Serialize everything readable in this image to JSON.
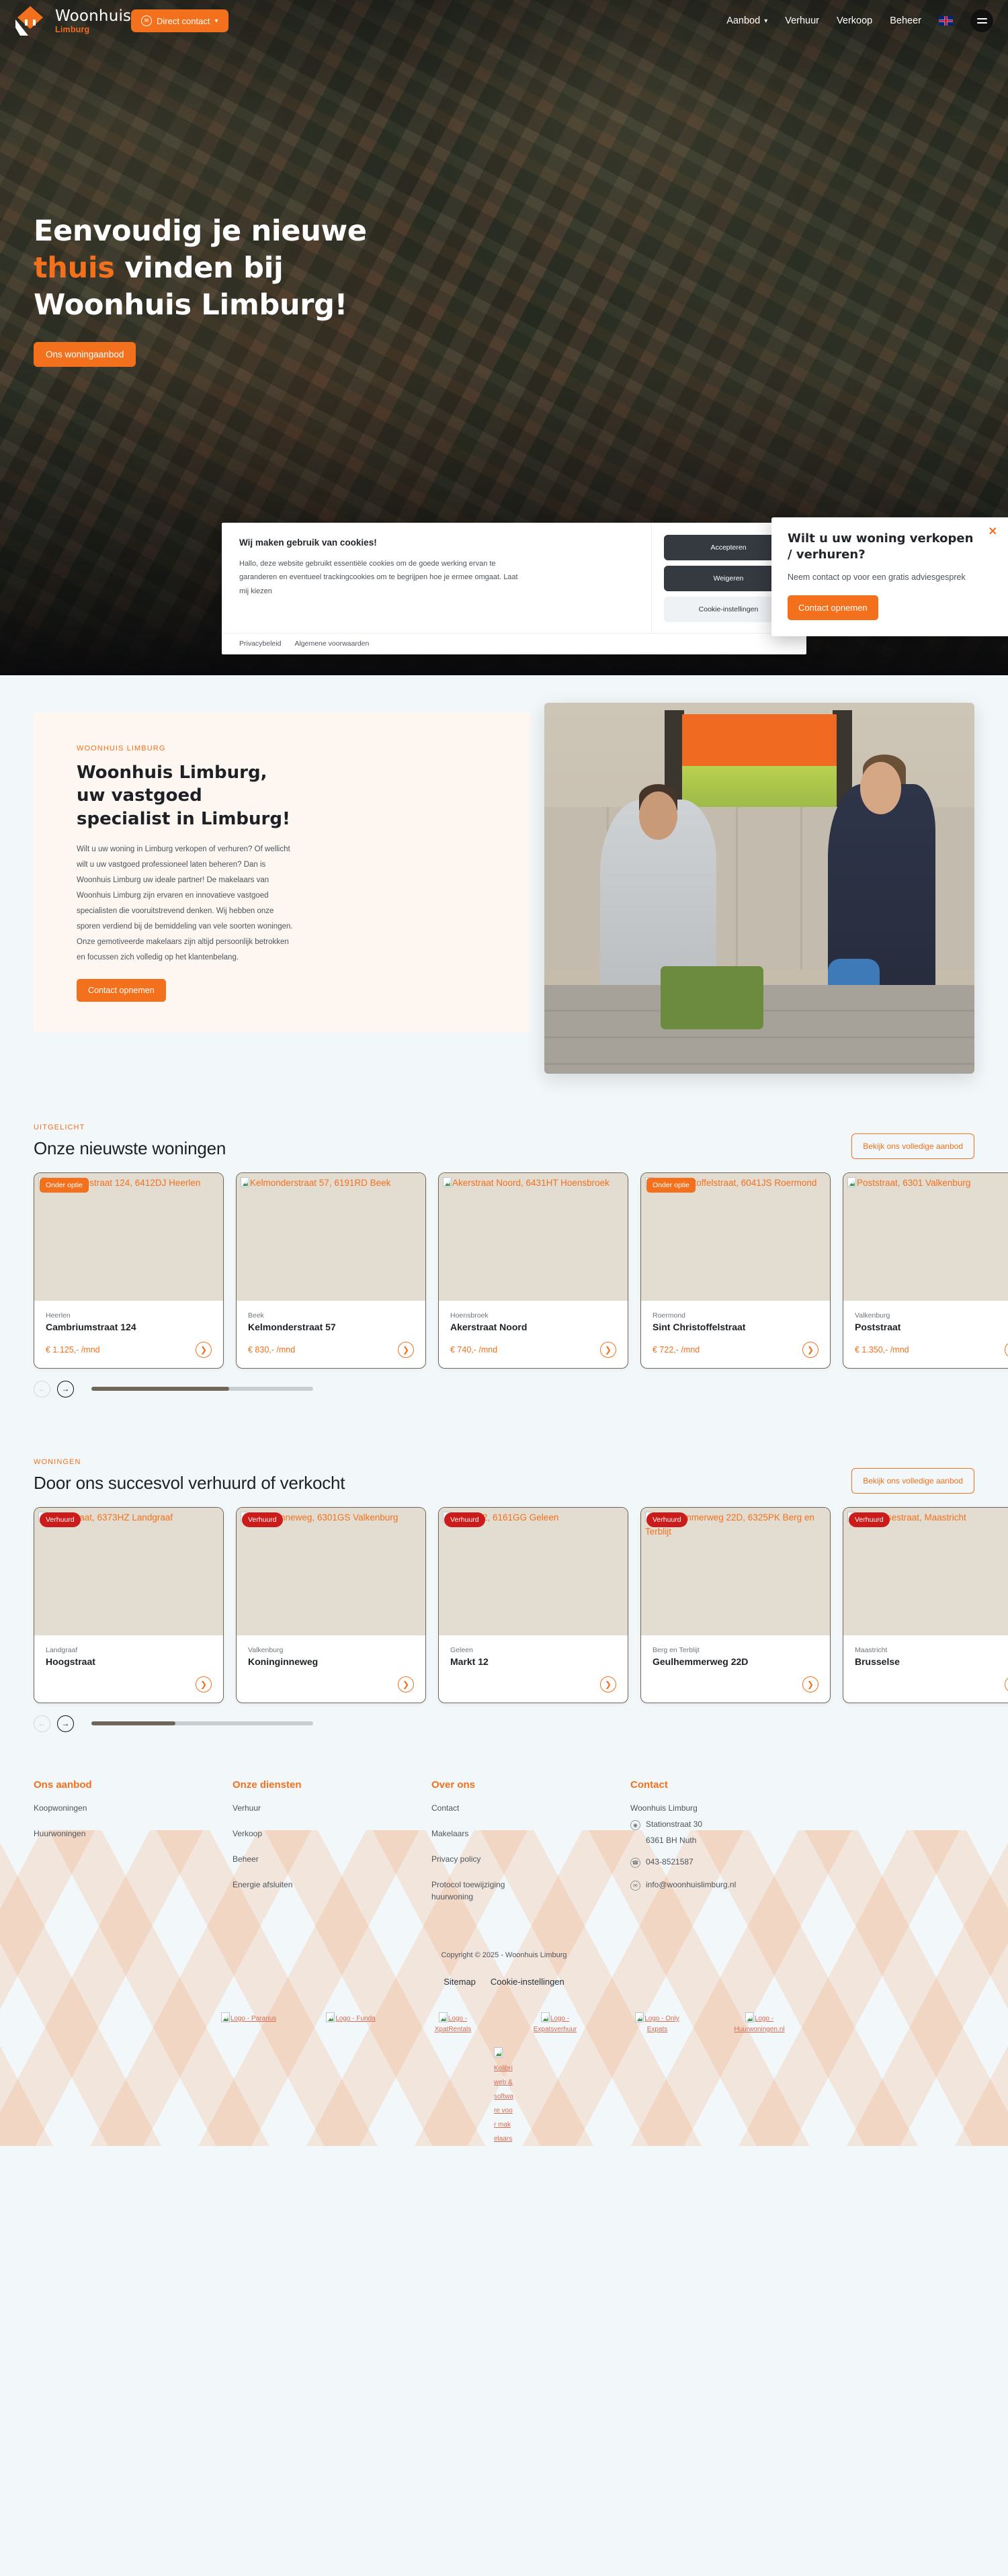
{
  "header": {
    "logo_main": "Woonhuis",
    "logo_sub": "Limburg",
    "direct_contact": "Direct contact",
    "nav": [
      {
        "label": "Aanbod",
        "has_chevron": true
      },
      {
        "label": "Verhuur",
        "has_chevron": false
      },
      {
        "label": "Verkoop",
        "has_chevron": false
      },
      {
        "label": "Beheer",
        "has_chevron": false
      }
    ],
    "language_icon": "uk-flag-icon",
    "menu_icon": "hamburger-menu-icon"
  },
  "hero": {
    "title_line1": "Eenvoudig je nieuwe",
    "title_accent": "thuis",
    "title_line2_rest": " vinden bij",
    "title_line3": "Woonhuis Limburg!",
    "cta": "Ons woningaanbod"
  },
  "cookie_banner": {
    "title": "Wij maken gebruik van cookies!",
    "body": "Hallo, deze website gebruikt essentiële cookies om de goede werking ervan te garanderen en eventueel trackingcookies om te begrijpen hoe je ermee omgaat. Laat mij kiezen",
    "accept": "Accepteren",
    "decline": "Weigeren",
    "settings": "Cookie-instellingen",
    "link_privacy": "Privacybeleid",
    "link_terms": "Algemene voorwaarden"
  },
  "sell_popup": {
    "title": "Wilt u uw woning verkopen / verhuren?",
    "text": "Neem contact op voor een gratis adviesgesprek",
    "button": "Contact opnemen",
    "close": "✕"
  },
  "about": {
    "eyebrow": "WOONHUIS LIMBURG",
    "heading": "Woonhuis Limburg, uw vastgoed specialist in Limburg!",
    "paragraph": "Wilt u uw woning in Limburg verkopen of verhuren? Of wellicht wilt u uw vastgoed professioneel laten beheren? Dan is Woonhuis Limburg uw ideale partner! De makelaars van Woonhuis Limburg zijn ervaren en innovatieve vastgoed specialisten die vooruitstrevend denken. Wij hebben onze sporen verdiend bij de bemiddeling van vele soorten woningen. Onze gemotiveerde makelaars zijn altijd persoonlijk betrokken en focussen zich volledig op het klantenbelang.",
    "button": "Contact opnemen",
    "photo_alt": "two-makelaars-at-laptop-photo"
  },
  "featured": {
    "eyebrow": "UITGELICHT",
    "title": "Onze nieuwste woningen",
    "view_all": "Bekijk ons volledige aanbod",
    "cards": [
      {
        "alt": "Cambriumstraat 124, 6412DJ Heerlen",
        "badge": "Onder optie",
        "badge_type": "optie",
        "city": "Heerlen",
        "street": "Cambriumstraat 124",
        "price": "€ 1.125,- /mnd"
      },
      {
        "alt": "Kelmonderstraat 57, 6191RD Beek",
        "badge": "",
        "badge_type": "",
        "city": "Beek",
        "street": "Kelmonderstraat 57",
        "price": "€ 830,- /mnd"
      },
      {
        "alt": "Akerstraat Noord, 6431HT Hoensbroek",
        "badge": "",
        "badge_type": "",
        "city": "Hoensbroek",
        "street": "Akerstraat Noord",
        "price": "€ 740,- /mnd"
      },
      {
        "alt": "Sint Christoffelstraat, 6041JS Roermond",
        "badge": "Onder optie",
        "badge_type": "optie",
        "city": "Roermond",
        "street": "Sint Christoffelstraat",
        "price": "€ 722,- /mnd"
      },
      {
        "alt": "Poststraat, 6301 Valkenburg",
        "badge": "",
        "badge_type": "",
        "city": "Valkenburg",
        "street": "Poststraat",
        "price": "€ 1.350,- /mnd"
      }
    ],
    "carousel": {
      "prev": "←",
      "next": "→",
      "progress_percent": 62
    }
  },
  "sold": {
    "eyebrow": "WONINGEN",
    "title": "Door ons succesvol verhuurd of verkocht",
    "view_all": "Bekijk ons volledige aanbod",
    "cards": [
      {
        "alt": "Hoogstraat, 6373HZ Landgraaf",
        "badge": "Verhuurd",
        "badge_type": "verhuurd",
        "city": "Landgraaf",
        "street": "Hoogstraat",
        "price": ""
      },
      {
        "alt": "Koninginneweg, 6301GS Valkenburg",
        "badge": "Verhuurd",
        "badge_type": "verhuurd",
        "city": "Valkenburg",
        "street": "Koninginneweg",
        "price": ""
      },
      {
        "alt": "Markt 12, 6161GG Geleen",
        "badge": "Verhuurd",
        "badge_type": "verhuurd",
        "city": "Geleen",
        "street": "Markt 12",
        "price": ""
      },
      {
        "alt": "Geulhemmerweg 22D, 6325PK Berg en Terblijt",
        "badge": "Verhuurd",
        "badge_type": "verhuurd",
        "city": "Berg en Terblijt",
        "street": "Geulhemmerweg 22D",
        "price": ""
      },
      {
        "alt": "Brusselsestraat, Maastricht",
        "badge": "Verhuurd",
        "badge_type": "verhuurd",
        "city": "Maastricht",
        "street": "Brusselse",
        "price": ""
      }
    ],
    "carousel": {
      "prev": "←",
      "next": "→",
      "progress_percent": 38
    }
  },
  "footer": {
    "columns": [
      {
        "title": "Ons aanbod",
        "links": [
          "Koopwoningen",
          "Huurwoningen"
        ]
      },
      {
        "title": "Onze diensten",
        "links": [
          "Verhuur",
          "Verkoop",
          "Beheer",
          "Energie afsluiten"
        ]
      },
      {
        "title": "Over ons",
        "links": [
          "Contact",
          "Makelaars",
          "Privacy policy",
          "Protocol toewijziging huurwoning"
        ]
      }
    ],
    "contact": {
      "title": "Contact",
      "company": "Woonhuis Limburg",
      "address_line1": "Stationstraat 30",
      "address_line2": "6361 BH Nuth",
      "phone": "043-8521587",
      "email": "info@woonhuislimburg.nl",
      "pin_icon": "location-pin-icon",
      "phone_icon": "phone-icon",
      "mail_icon": "envelope-icon"
    },
    "copyright": "Copyright © 2025 - Woonhuis Limburg",
    "bottom_links": [
      "Sitemap",
      "Cookie-instellingen"
    ],
    "partners": [
      "Logo - Pararius",
      "Logo - Funda",
      "Logo - XpatRentals",
      "Logo - Expatsverhuur",
      "Logo - Only Expats",
      "Logo - Huurwoningen.nl"
    ],
    "partner_last": "Kolibri web & software voor makelaars"
  }
}
